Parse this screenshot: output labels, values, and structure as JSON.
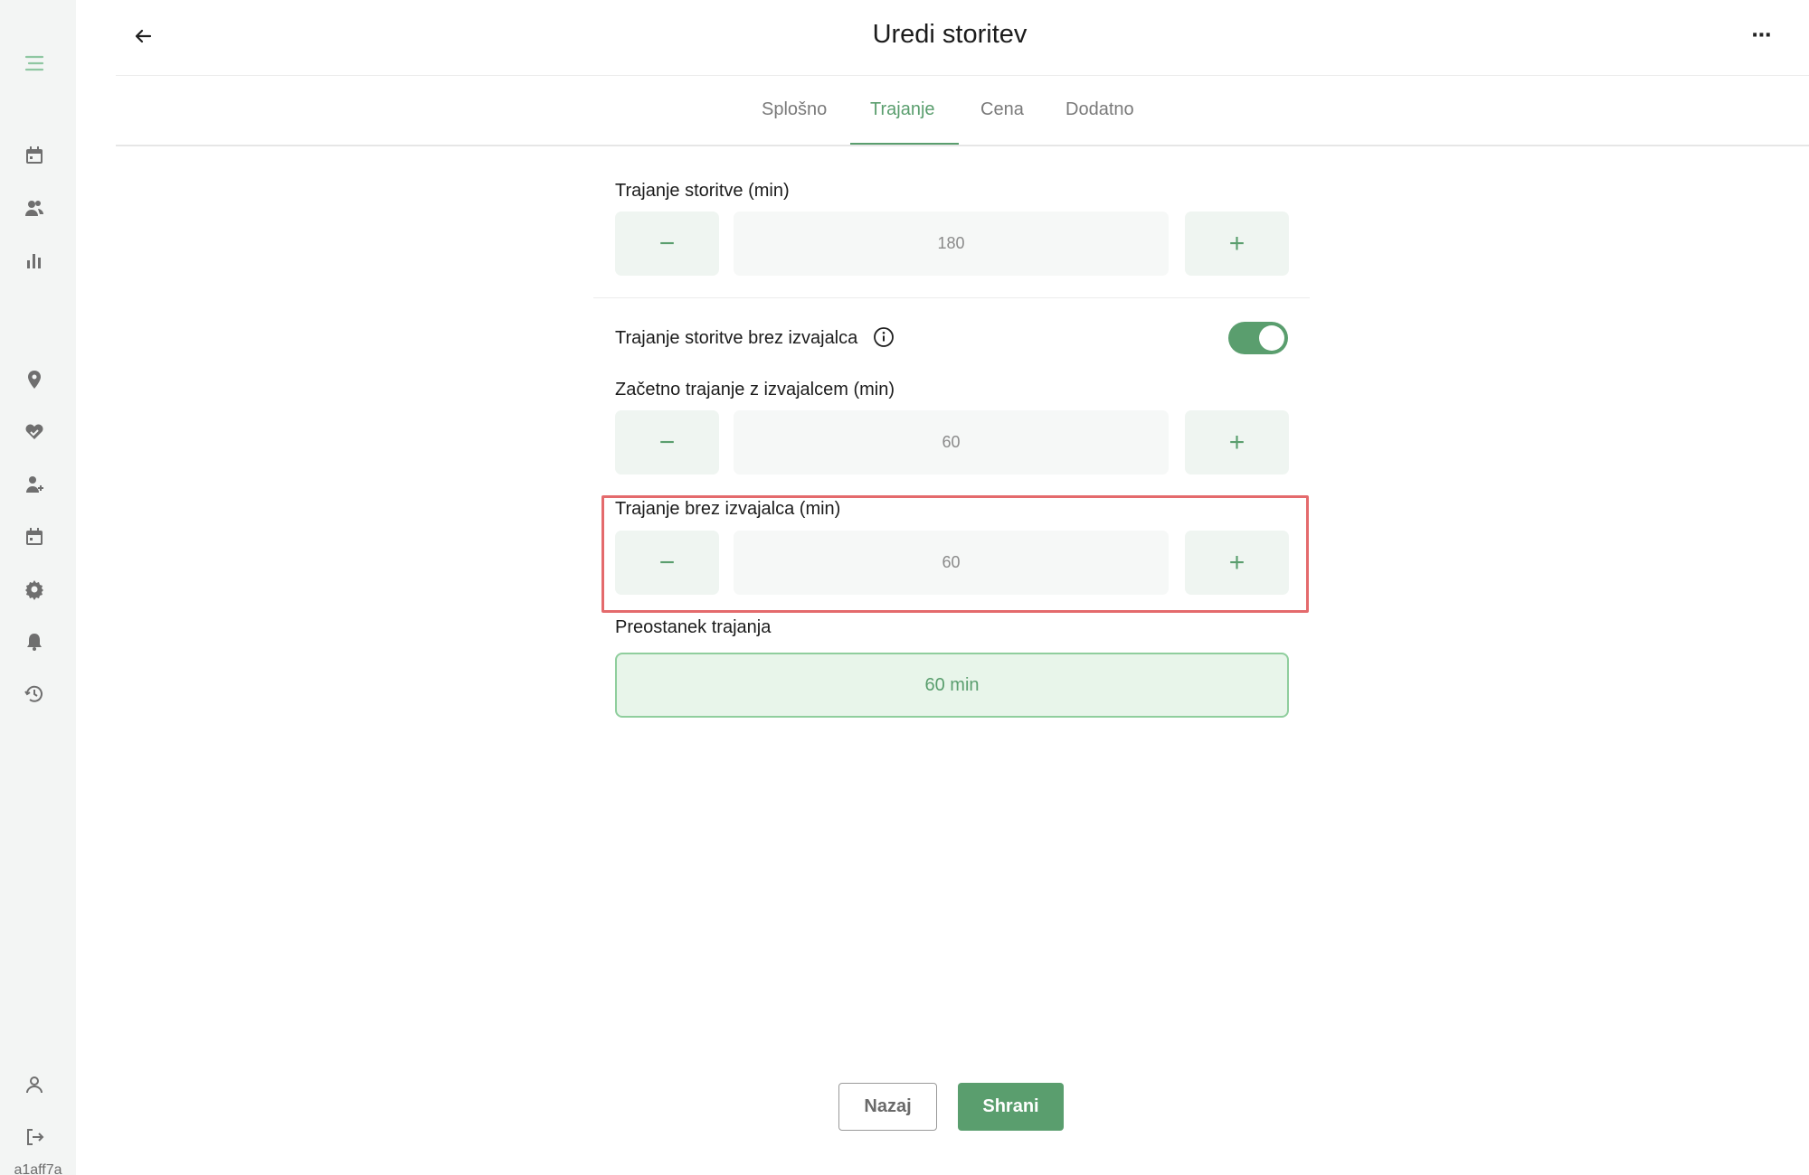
{
  "sidebar": {
    "items": [
      {
        "icon": "menu-icon"
      },
      {
        "icon": "calendar-icon"
      },
      {
        "icon": "users-icon"
      },
      {
        "icon": "bar-chart-icon"
      },
      {
        "icon": "location-pin-icon"
      },
      {
        "icon": "heart-hand-icon"
      },
      {
        "icon": "user-add-icon"
      },
      {
        "icon": "calendar-icon"
      },
      {
        "icon": "gear-icon"
      },
      {
        "icon": "bell-icon"
      },
      {
        "icon": "history-icon"
      },
      {
        "icon": "user-icon"
      },
      {
        "icon": "logout-icon"
      }
    ],
    "version": "a1aff7a"
  },
  "header": {
    "title": "Uredi storitev",
    "more": "⋯"
  },
  "tabs": [
    {
      "label": "Splošno",
      "active": false
    },
    {
      "label": "Trajanje",
      "active": true
    },
    {
      "label": "Cena",
      "active": false
    },
    {
      "label": "Dodatno",
      "active": false
    }
  ],
  "form": {
    "service_duration": {
      "label": "Trajanje storitve (min)",
      "value": "180",
      "minus": "−",
      "plus": "+"
    },
    "without_provider": {
      "label": "Trajanje storitve brez izvajalca",
      "enabled": true
    },
    "initial_duration": {
      "label": "Začetno trajanje z izvajalcem (min)",
      "value": "60",
      "minus": "−",
      "plus": "+"
    },
    "duration_without_provider": {
      "label": "Trajanje brez izvajalca (min)",
      "value": "60",
      "minus": "−",
      "plus": "+"
    },
    "remaining": {
      "label": "Preostanek trajanja",
      "value": "60 min"
    }
  },
  "footer": {
    "back_label": "Nazaj",
    "save_label": "Shrani"
  },
  "colors": {
    "accent": "#5a9e6e",
    "sidebar_bg": "#f3f5f4",
    "highlight": "#e46a6c"
  }
}
